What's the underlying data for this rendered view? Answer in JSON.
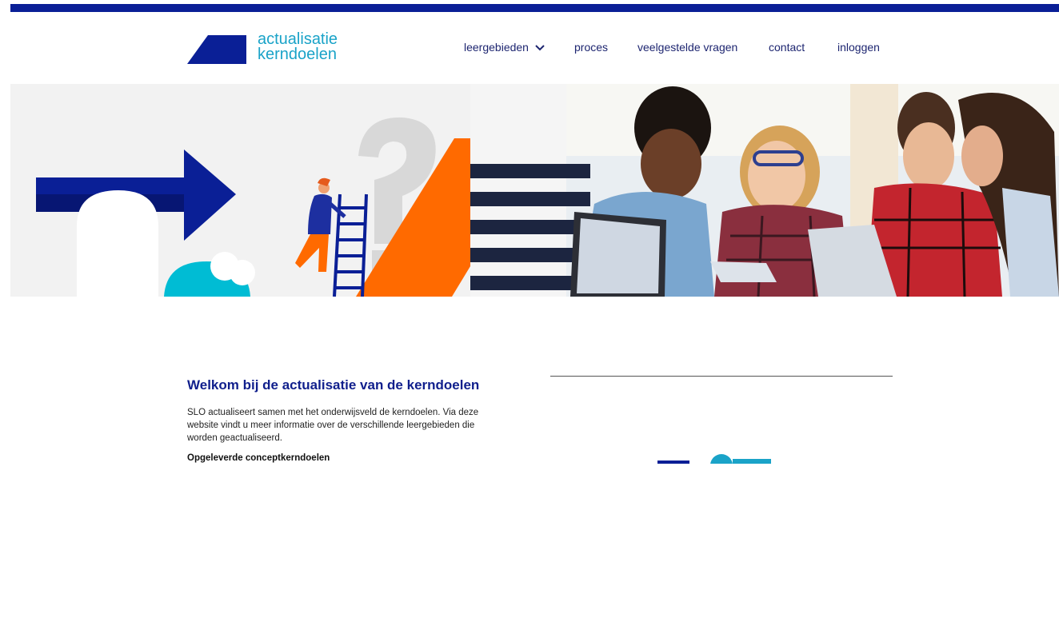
{
  "brand": {
    "line1": "actualisatie",
    "line2": "kerndoelen",
    "primary_color": "#0a1f96",
    "accent_color": "#1aa3c8",
    "orange": "#ff6a00"
  },
  "nav": {
    "items": [
      {
        "label": "leergebieden",
        "has_dropdown": true
      },
      {
        "label": "proces"
      },
      {
        "label": "veelgestelde vragen"
      },
      {
        "label": "contact"
      },
      {
        "label": "inloggen"
      }
    ],
    "dropdown_icon": "chevron-down-icon"
  },
  "hero": {
    "illustration_icons": [
      "arrow-right-icon",
      "question-mark-icon",
      "ladder-icon",
      "person-icon"
    ],
    "photo_subject": "students-with-tablets-photo"
  },
  "welcome": {
    "title": "Welkom bij de actualisatie van de kerndoelen",
    "intro": "SLO actualiseert samen met het onderwijsveld de kerndoelen. Via deze website vindt u meer informatie over de verschillende leergebieden die worden geactualiseerd.",
    "subheading": "Opgeleverde conceptkerndoelen"
  }
}
